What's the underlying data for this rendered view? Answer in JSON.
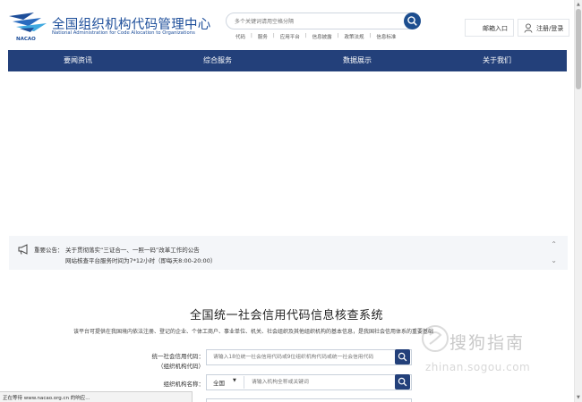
{
  "header": {
    "logo_title": "全国组织机构代码管理中心",
    "logo_subtitle": "National Administration for Code Allocation to Organizations",
    "logo_abbr": "NACAO",
    "search_placeholder": "多个关键词请用空格分隔",
    "quick_links": [
      "代码",
      "服务",
      "应用平台",
      "信息披露",
      "政策法规",
      "信息标准"
    ],
    "mail_label": "邮箱入口",
    "login_label": "注册/登录"
  },
  "nav": {
    "items": [
      "要闻资讯",
      "综合服务",
      "数据展示",
      "关于我们"
    ]
  },
  "notice": {
    "label": "重要公告：",
    "line1": "关于贯彻落实“三证合一、一照一码”改革工作的公告",
    "line2": "网站核查平台服务时间为7*12小时（即每天8:00-20:00）"
  },
  "query": {
    "title": "全国统一社会信用代码信息核查系统",
    "description": "该平台可提供在我国境内依法注册、登记的企业、个体工商户、事业单位、机关、社会组织及其他组织机构的基本信息，是我国社会信用体系的重要基础",
    "credit_code_label": "统一社会信用代码：",
    "credit_code_sublabel": "（组织机构代码）",
    "credit_code_placeholder": "请输入18位统一社会信用代码或9位组织机构代码或统一社会信用代码",
    "org_name_label": "组织机构名称：",
    "org_name_select": "全国",
    "org_name_placeholder": "请输入机构全称或关键词"
  },
  "watermark": {
    "text": "搜狗指南",
    "sub": "zhinan.sogou.com"
  },
  "status_bar": {
    "text": "正在等待 www.nacao.org.cn 的响应..."
  },
  "colors": {
    "brand_blue": "#23407a",
    "logo_blue": "#1d4e9a"
  }
}
